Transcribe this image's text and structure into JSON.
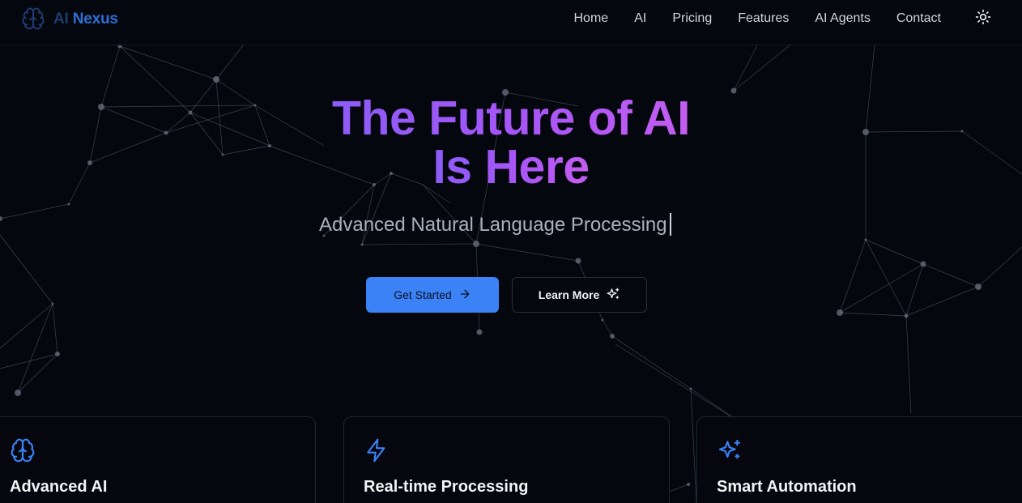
{
  "brand": {
    "name_part1": "AI",
    "name_part2": "Nexus",
    "logo_icon": "brain-icon",
    "color_part1": "#1e3a6e",
    "color_part2": "#2f6fd6"
  },
  "nav": {
    "items": [
      {
        "label": "Home"
      },
      {
        "label": "AI"
      },
      {
        "label": "Pricing"
      },
      {
        "label": "Features"
      },
      {
        "label": "AI Agents"
      },
      {
        "label": "Contact"
      }
    ],
    "theme_toggle_icon": "sun-icon"
  },
  "hero": {
    "title_line1": "The Future of AI",
    "title_line2": "Is Here",
    "subtitle": "Advanced Natural Language Processing",
    "gradient": [
      "#8b5cf6",
      "#a855f7",
      "#c45df0"
    ]
  },
  "buttons": {
    "primary_label": "Get Started",
    "primary_icon": "arrow-right-icon",
    "secondary_label": "Learn More",
    "secondary_icon": "sparkles-icon",
    "accent": "#3b82f6"
  },
  "features": [
    {
      "title": "Advanced AI",
      "icon": "brain-icon"
    },
    {
      "title": "Real-time Processing",
      "icon": "lightning-icon"
    },
    {
      "title": "Smart Automation",
      "icon": "sparkles-icon"
    }
  ]
}
